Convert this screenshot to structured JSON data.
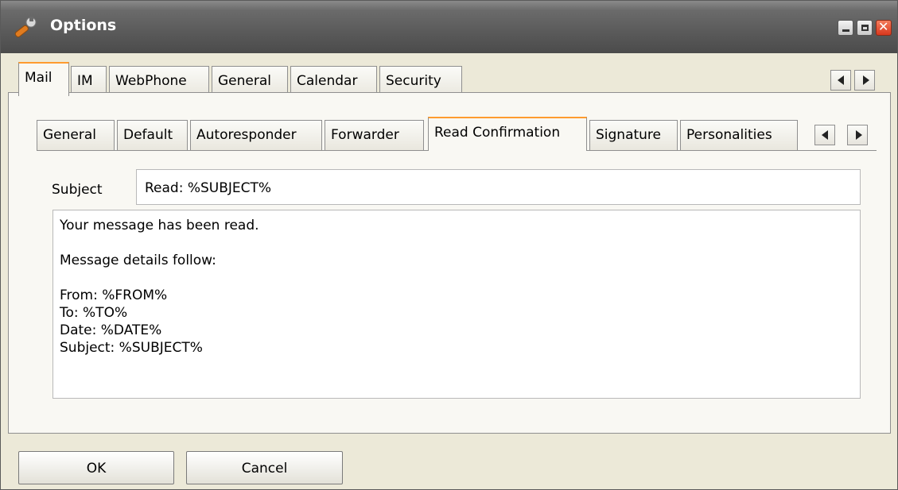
{
  "window": {
    "title": "Options",
    "icon": "wrench-icon"
  },
  "main_tabs": [
    {
      "label": "Mail",
      "active": true
    },
    {
      "label": "IM",
      "active": false
    },
    {
      "label": "WebPhone",
      "active": false
    },
    {
      "label": "General",
      "active": false
    },
    {
      "label": "Calendar",
      "active": false
    },
    {
      "label": "Security",
      "active": false
    }
  ],
  "sub_tabs": [
    {
      "label": "General",
      "active": false
    },
    {
      "label": "Default",
      "active": false
    },
    {
      "label": "Autoresponder",
      "active": false
    },
    {
      "label": "Forwarder",
      "active": false
    },
    {
      "label": "Read Confirmation",
      "active": true
    },
    {
      "label": "Signature",
      "active": false
    },
    {
      "label": "Personalities",
      "active": false
    }
  ],
  "form": {
    "subject_label": "Subject",
    "subject_value": "Read: %SUBJECT%",
    "body_lines": [
      "Your message has been read.",
      "",
      "Message details follow:",
      "",
      "From: %FROM%",
      "To: %TO%",
      "Date: %DATE%",
      "Subject: %SUBJECT%"
    ]
  },
  "buttons": {
    "ok": "OK",
    "cancel": "Cancel"
  },
  "colors": {
    "active_tab_accent": "#ff9b2f",
    "titlebar": "#5a5a5a",
    "dialog_bg": "#ece9d8"
  }
}
